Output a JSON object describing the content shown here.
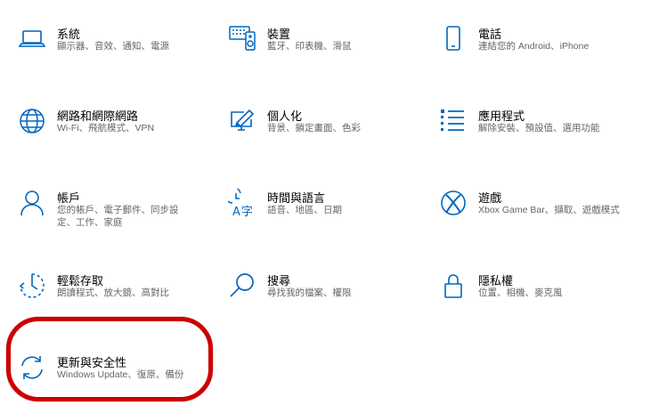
{
  "accent_color": "#0067c0",
  "highlight_color": "#cc0000",
  "tiles": [
    {
      "title": "系統",
      "desc": "顯示器、音效、通知、電源",
      "icon": "laptop-icon"
    },
    {
      "title": "裝置",
      "desc": "藍牙、印表機、滑鼠",
      "icon": "devices-icon"
    },
    {
      "title": "電話",
      "desc": "連結您的 Android、iPhone",
      "icon": "phone-icon"
    },
    {
      "title": "網路和網際網路",
      "desc": "Wi-Fi、飛航模式、VPN",
      "icon": "globe-icon"
    },
    {
      "title": "個人化",
      "desc": "背景、鎖定畫面、色彩",
      "icon": "personalization-icon"
    },
    {
      "title": "應用程式",
      "desc": "解除安裝、預設值、選用功能",
      "icon": "apps-icon"
    },
    {
      "title": "帳戶",
      "desc": "您的帳戶、電子郵件、同步設定、工作、家庭",
      "icon": "person-icon"
    },
    {
      "title": "時間與語言",
      "desc": "語音、地區、日期",
      "icon": "time-language-icon"
    },
    {
      "title": "遊戲",
      "desc": "Xbox Game Bar、擷取、遊戲模式",
      "icon": "xbox-icon"
    },
    {
      "title": "輕鬆存取",
      "desc": "朗讀程式、放大鏡、高對比",
      "icon": "ease-of-access-icon"
    },
    {
      "title": "搜尋",
      "desc": "尋找我的檔案、權限",
      "icon": "search-icon"
    },
    {
      "title": "隱私權",
      "desc": "位置、相機、麥克風",
      "icon": "lock-icon"
    },
    {
      "title": "更新與安全性",
      "desc": "Windows Update、復原、備份",
      "icon": "update-icon"
    }
  ]
}
